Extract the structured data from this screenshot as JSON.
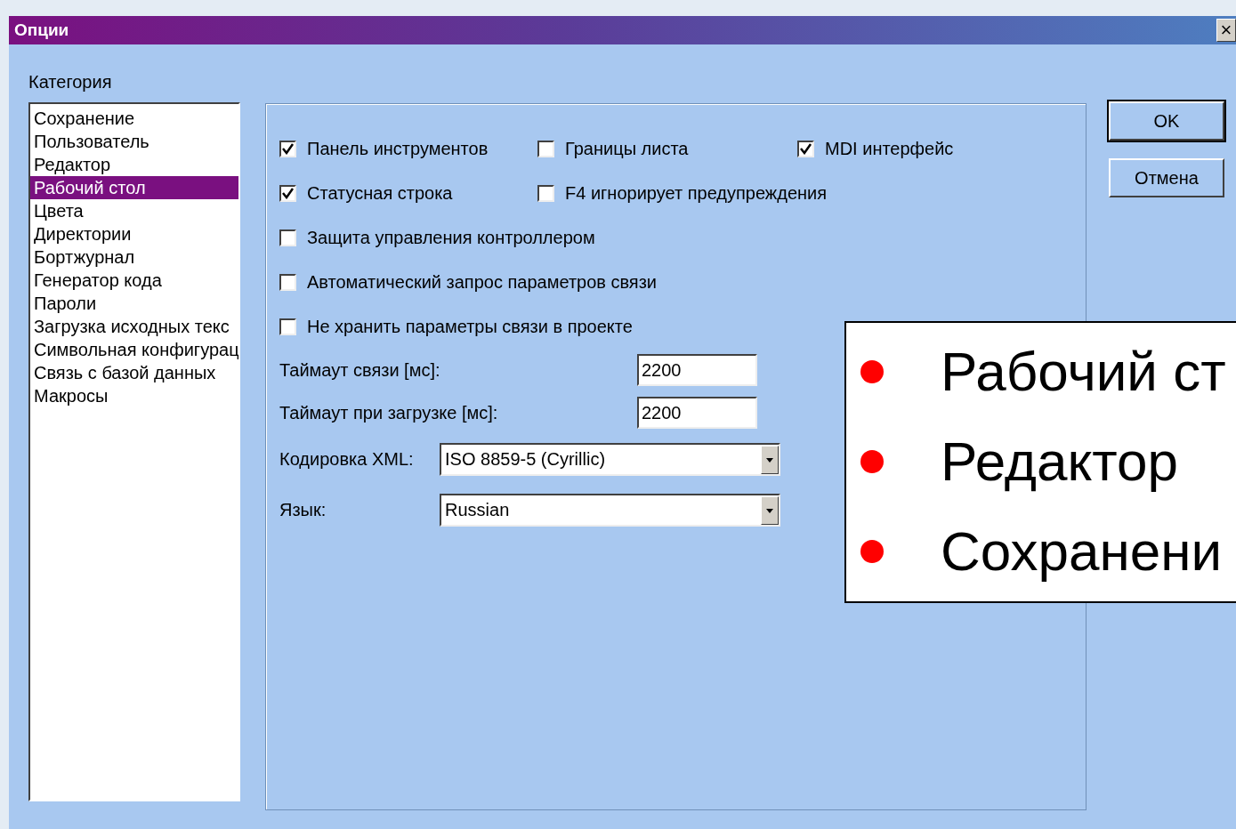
{
  "window": {
    "title": "Опции",
    "close": "×"
  },
  "category": {
    "label": "Категория",
    "items": [
      {
        "label": "Сохранение",
        "selected": false
      },
      {
        "label": "Пользователь",
        "selected": false
      },
      {
        "label": "Редактор",
        "selected": false
      },
      {
        "label": "Рабочий стол",
        "selected": true
      },
      {
        "label": "Цвета",
        "selected": false
      },
      {
        "label": "Директории",
        "selected": false
      },
      {
        "label": "Бортжурнал",
        "selected": false
      },
      {
        "label": "Генератор кода",
        "selected": false
      },
      {
        "label": "Пароли",
        "selected": false
      },
      {
        "label": "Загрузка исходных текс",
        "selected": false
      },
      {
        "label": "Символьная конфигурац",
        "selected": false
      },
      {
        "label": "Связь с базой данных",
        "selected": false
      },
      {
        "label": "Макросы",
        "selected": false
      }
    ]
  },
  "checkbox_rows": [
    [
      {
        "label": "Панель инструментов",
        "checked": true
      },
      {
        "label": "Границы листа",
        "checked": false
      },
      {
        "label": "MDI интерфейс",
        "checked": true
      }
    ],
    [
      {
        "label": "Статусная строка",
        "checked": true
      },
      {
        "label": "F4 игнорирует предупреждения",
        "checked": false
      }
    ],
    [
      {
        "label": "Защита управления контроллером",
        "checked": false
      }
    ],
    [
      {
        "label": "Автоматический запрос параметров связи",
        "checked": false
      }
    ],
    [
      {
        "label": "Не хранить параметры связи в проекте",
        "checked": false
      }
    ]
  ],
  "fields": [
    {
      "label": "Таймаут связи [мс]:",
      "value": "2200"
    },
    {
      "label": "Таймаут при загрузке [мс]:",
      "value": "2200"
    }
  ],
  "combos": [
    {
      "label": "Кодировка XML:",
      "value": "ISO 8859-5 (Cyrillic)"
    },
    {
      "label": "Язык:",
      "value": "Russian"
    }
  ],
  "buttons": [
    {
      "label": "OK",
      "default": true
    },
    {
      "label": "Отмена",
      "default": false
    }
  ],
  "callout": {
    "items": [
      "Рабочий ст",
      "Редактор",
      "Сохранени"
    ]
  }
}
